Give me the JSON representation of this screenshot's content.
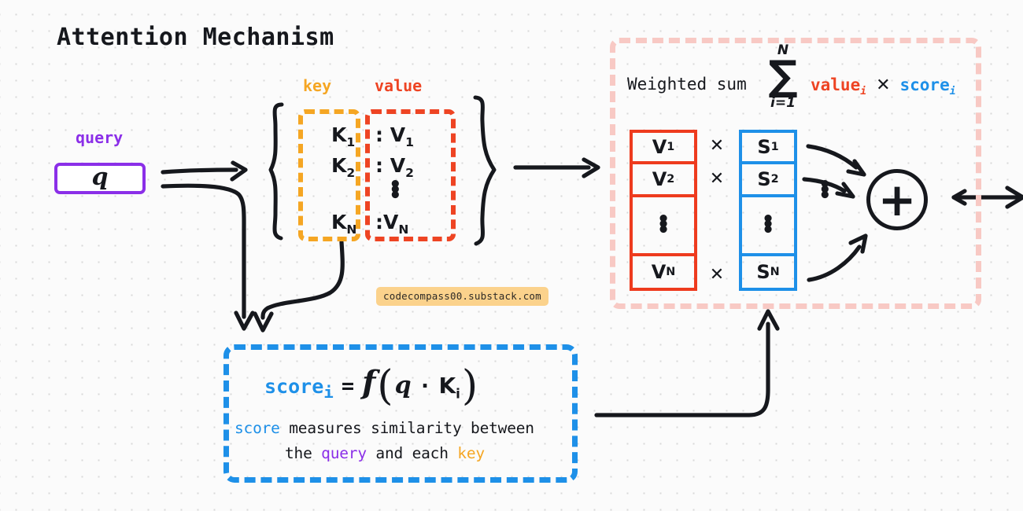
{
  "title": "Attention Mechanism",
  "labels": {
    "query": "query",
    "key": "key",
    "value": "value"
  },
  "query_box": {
    "symbol": "q"
  },
  "key_items": [
    "K₁",
    "K₂",
    "Kₙ"
  ],
  "value_items": [
    "· V₁",
    "· V₂",
    "· Vₙ"
  ],
  "key_value": {
    "k1_base": "K",
    "k1_sub": "1",
    "k2_base": "K",
    "k2_sub": "2",
    "kn_base": "K",
    "kn_sub": "N",
    "v1_base": ": V",
    "v1_sub": "1",
    "v2_base": ": V",
    "v2_sub": "2",
    "vn_base": ":V",
    "vn_sub": "N",
    "vertical_dots": "•"
  },
  "watermark": "codecompass00.substack.com",
  "score_formula": {
    "score_label": "score",
    "score_sub": "i",
    "equals": "=",
    "function": "f",
    "open_paren": "(",
    "query_symbol": "q",
    "dot": "·",
    "key_base": "K",
    "key_sub": "i",
    "close_paren": ")"
  },
  "score_caption": {
    "line1_part1": "score",
    "line1_part2": " measures similarity between",
    "line2_part1": "the ",
    "line2_query": "query",
    "line2_part2": " and each ",
    "line2_key": "key"
  },
  "weighted_sum": {
    "label": "Weighted sum",
    "sigma_upper": "N",
    "sigma": "∑",
    "sigma_lower": "i=1",
    "term_value": "value",
    "term_value_sub": "i",
    "term_times": "✕",
    "term_score": "score",
    "term_score_sub": "i"
  },
  "v_column": {
    "cells": [
      {
        "base": "V",
        "sub": "1"
      },
      {
        "base": "V",
        "sub": "2"
      },
      {
        "base": "",
        "sub": ""
      },
      {
        "base": "V",
        "sub": "N"
      }
    ],
    "dots": "•"
  },
  "s_column": {
    "cells": [
      {
        "base": "S",
        "sub": "1"
      },
      {
        "base": "S",
        "sub": "2"
      },
      {
        "base": "",
        "sub": ""
      },
      {
        "base": "S",
        "sub": "N"
      }
    ],
    "dots": "•"
  },
  "multiply_symbols": [
    "✕",
    "✕",
    "✕"
  ],
  "middle_dots": "•",
  "plus_symbol": "+",
  "colors": {
    "query_purple": "#8b2fe8",
    "key_orange": "#f5a623",
    "value_red": "#ee4423",
    "score_blue": "#1e90e8",
    "panel_pink": "#f8c9c4",
    "ink": "#16181d",
    "watermark_bg": "#fbd28c",
    "background": "#fbfbfb",
    "dot_grid": "#d8d8d8"
  }
}
